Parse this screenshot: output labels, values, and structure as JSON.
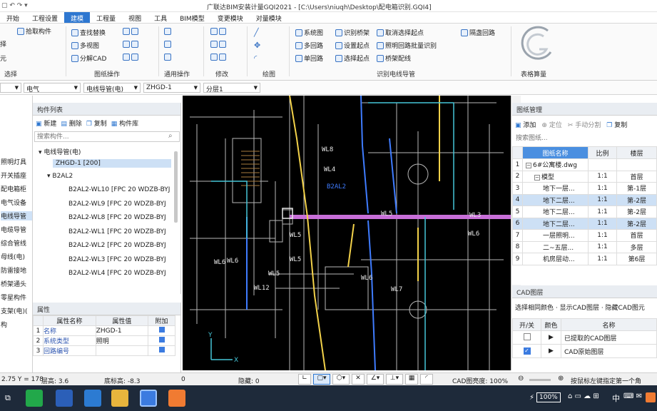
{
  "title_bar": {
    "title": "广联达BIM安装计量GQI2021 - [C:\\Users\\niuqh\\Desktop\\配电箱识别.GQI4]"
  },
  "menu": [
    "开始",
    "工程设置",
    "建模",
    "工程量",
    "视图",
    "工具",
    "BIM模型",
    "变更模块",
    "对量模块"
  ],
  "ribbon": {
    "left_cut": [
      "拾取构件",
      "择",
      "元"
    ],
    "select_group": "选择",
    "drawing_ops": [
      "查找替换",
      "多视图",
      "分解CAD"
    ],
    "drawing_ops_group": "图纸操作",
    "general_ops_group": "通用操作",
    "modify_group": "修改",
    "draw_group": "绘图",
    "wire_identify": [
      "系统图",
      "识别桥架",
      "取消选择起点",
      "隔盏回路",
      "多回路",
      "设置起点",
      "照明回路批量识别",
      "单回路",
      "选择起点",
      "桥架配线"
    ],
    "wire_identify_group": "识别电线导管",
    "table_calc_group": "表格算量"
  },
  "selector_bar": {
    "discipline": "电气",
    "type": "电线导管(电)",
    "component": "ZHGD-1",
    "floor": "分层1"
  },
  "nav_panel": {
    "items": [
      "照明灯具",
      "开关插座",
      "配电箱柜",
      "电气设备",
      "电线导管",
      "电缆导管",
      "综合管线",
      "母线(电)",
      "防雷接地",
      "桥架通头",
      "零星构件",
      "支架(电)(",
      "构"
    ],
    "selected_index": 4
  },
  "component_list": {
    "header": "构件列表",
    "toolbar": [
      "新建",
      "删除",
      "复制",
      "构件库"
    ],
    "search_placeholder": "搜索构件...",
    "root": "电线导管(电)",
    "selected": "ZHGD-1 [200]",
    "group": "B2AL2",
    "items": [
      "B2AL2-WL10 [FPC 20 WDZB-BYJ",
      "B2AL2-WL9 [FPC 20 WDZB-BYJ",
      "B2AL2-WL8 [FPC 20 WDZB-BYJ",
      "B2AL2-WL1 [FPC 20 WDZB-BYJ",
      "B2AL2-WL2 [FPC 20 WDZB-BYJ",
      "B2AL2-WL3 [FPC 20 WDZB-BYJ",
      "B2AL2-WL4 [FPC 20 WDZB-BYJ"
    ]
  },
  "properties": {
    "header": "属性",
    "columns": [
      "属性名称",
      "属性值",
      "附加"
    ],
    "rows": [
      {
        "no": "1",
        "name": "名称",
        "value": "ZHGD-1"
      },
      {
        "no": "2",
        "name": "系统类型",
        "value": "照明"
      },
      {
        "no": "3",
        "name": "回路编号",
        "value": ""
      }
    ]
  },
  "cad_labels": [
    "WL8",
    "WL4",
    "WL5",
    "WL6",
    "WL5",
    "WL6",
    "WL7",
    "WL5",
    "WL3",
    "WL12",
    "WL6",
    "WL6",
    "WL5",
    "B2AL2"
  ],
  "drawing_manager": {
    "header": "图纸管理",
    "toolbar": [
      "添加",
      "定位",
      "手动分割",
      "复制"
    ],
    "search_placeholder": "搜索图纸...",
    "columns": [
      "图纸名称",
      "比例",
      "楼层"
    ],
    "rows": [
      {
        "no": "1",
        "name": "6#公寓楼.dwg",
        "scale": "",
        "floor": "",
        "indent": 0,
        "toggle": "−"
      },
      {
        "no": "2",
        "name": "模型",
        "scale": "1:1",
        "floor": "首层",
        "indent": 1,
        "toggle": "−"
      },
      {
        "no": "3",
        "name": "地下一层...",
        "scale": "1:1",
        "floor": "第-1层",
        "indent": 2,
        "toggle": ""
      },
      {
        "no": "4",
        "name": "地下二层...",
        "scale": "1:1",
        "floor": "第-2层",
        "indent": 2,
        "toggle": ""
      },
      {
        "no": "5",
        "name": "地下二层...",
        "scale": "1:1",
        "floor": "第-2层",
        "indent": 2,
        "toggle": ""
      },
      {
        "no": "6",
        "name": "地下二层...",
        "scale": "1:1",
        "floor": "第-2层",
        "indent": 2,
        "toggle": ""
      },
      {
        "no": "7",
        "name": "一层照明...",
        "scale": "1:1",
        "floor": "首层",
        "indent": 2,
        "toggle": ""
      },
      {
        "no": "8",
        "name": "二~五层...",
        "scale": "1:1",
        "floor": "多层",
        "indent": 2,
        "toggle": ""
      },
      {
        "no": "9",
        "name": "机房层动...",
        "scale": "1:1",
        "floor": "第6层",
        "indent": 2,
        "toggle": ""
      }
    ],
    "selected_rows": [
      4,
      6
    ]
  },
  "cad_layers": {
    "header": "CAD图层",
    "toolbar": "选择相同颜色 · 显示CAD图层 · 隐藏CAD图元",
    "columns": [
      "开/关",
      "颜色",
      "名称"
    ],
    "rows": [
      {
        "checked": false,
        "name": "已提取的CAD图层"
      },
      {
        "checked": true,
        "name": "CAD原始图层"
      }
    ]
  },
  "status_bar": {
    "coords": "2.75 Y = 178",
    "floor_height": "层高: 3.6",
    "base_elev": "底标高: -8.3",
    "zero": "0",
    "hidden": "隐藏: 0",
    "cad_brightness": "CAD图亮度: 100%",
    "hint": "按鼠标左键指定第一个角"
  },
  "taskbar": {
    "battery": "100%",
    "lang": "中"
  },
  "colors": {
    "accent": "#2e77d0",
    "selection": "#cde0f5",
    "cad_bg": "#000000",
    "magenta": "#c86fd8",
    "yellow": "#f3d24a",
    "blue": "#3f7cff",
    "cyan": "#46c6d8"
  }
}
